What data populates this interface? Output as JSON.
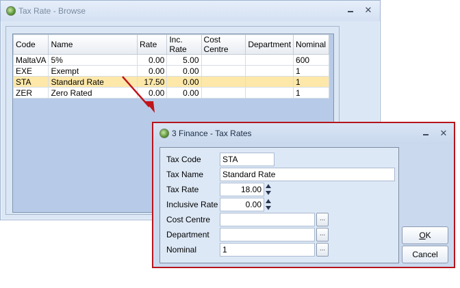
{
  "browse": {
    "title": "Tax Rate - Browse",
    "columns": [
      "Code",
      "Name",
      "Rate",
      "Inc. Rate",
      "Cost Centre",
      "Department",
      "Nominal"
    ],
    "rows": [
      {
        "code": "MaltaVA",
        "name": "5%",
        "rate": "0.00",
        "inc_rate": "5.00",
        "cost_centre": "",
        "department": "",
        "nominal": "600",
        "selected": false
      },
      {
        "code": "EXE",
        "name": "Exempt",
        "rate": "0.00",
        "inc_rate": "0.00",
        "cost_centre": "",
        "department": "",
        "nominal": "1",
        "selected": false
      },
      {
        "code": "STA",
        "name": "Standard Rate",
        "rate": "17.50",
        "inc_rate": "0.00",
        "cost_centre": "",
        "department": "",
        "nominal": "1",
        "selected": true
      },
      {
        "code": "ZER",
        "name": "Zero Rated",
        "rate": "0.00",
        "inc_rate": "0.00",
        "cost_centre": "",
        "department": "",
        "nominal": "1",
        "selected": false
      }
    ]
  },
  "dialog": {
    "title": "3 Finance - Tax Rates",
    "fields": {
      "tax_code": {
        "label": "Tax Code",
        "value": "STA"
      },
      "tax_name": {
        "label": "Tax Name",
        "value": "Standard Rate"
      },
      "tax_rate": {
        "label": "Tax Rate",
        "value": "18.00"
      },
      "inclusive_rate": {
        "label": "Inclusive Rate",
        "value": "0.00"
      },
      "cost_centre": {
        "label": "Cost Centre",
        "value": ""
      },
      "department": {
        "label": "Department",
        "value": ""
      },
      "nominal": {
        "label": "Nominal",
        "value": "1"
      }
    },
    "ellipsis_label": "...",
    "ok_accel": "O",
    "ok_rest": "K",
    "cancel_label": "Cancel"
  },
  "colors": {
    "selected_row": "#fde8a9",
    "dialog_border": "#b5141c",
    "arrow": "#c0141c"
  },
  "icons": {
    "app": "app-globe-icon",
    "minimize": "minimize-icon",
    "close": "close-icon",
    "spin_up": "spin-up-icon",
    "spin_down": "spin-down-icon",
    "pointer": "arrow-icon"
  }
}
